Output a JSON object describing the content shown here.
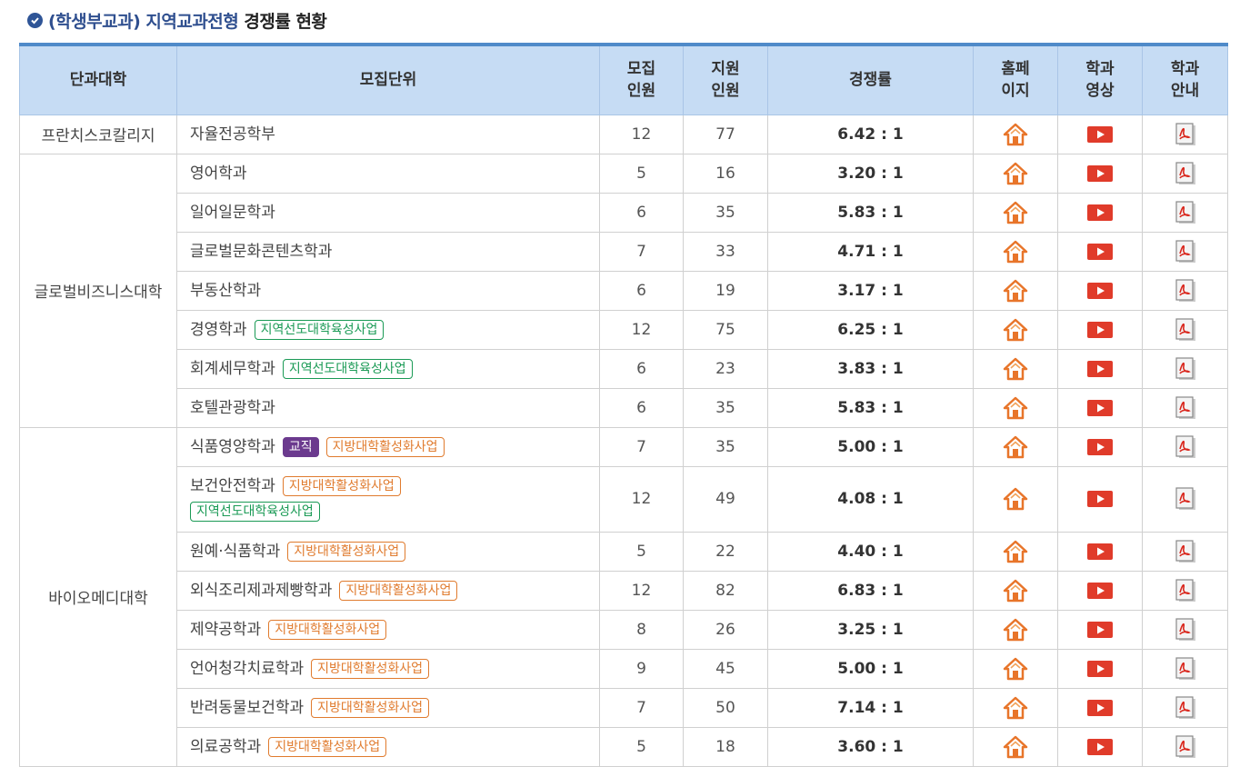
{
  "header": {
    "title_prefix": "(학생부교과) 지역교과전형",
    "title_suffix": "경쟁률 현황",
    "check_icon": "check-circle-icon"
  },
  "table": {
    "columns": {
      "college": "단과대학",
      "unit": "모집단위",
      "quota_line1": "모집",
      "quota_line2": "인원",
      "applicants_line1": "지원",
      "applicants_line2": "인원",
      "ratio": "경쟁률",
      "homepage_line1": "홈페",
      "homepage_line2": "이지",
      "video_line1": "학과",
      "video_line2": "영상",
      "guide_line1": "학과",
      "guide_line2": "안내"
    },
    "colleges": [
      "프란치스코칼리지",
      "글로벌비즈니스대학",
      "바이오메디대학"
    ],
    "rows": [
      {
        "unit": "자율전공학부",
        "quota": "12",
        "applicants": "77",
        "ratio": "6.42 : 1"
      },
      {
        "unit": "영어학과",
        "quota": "5",
        "applicants": "16",
        "ratio": "3.20 : 1"
      },
      {
        "unit": "일어일문학과",
        "quota": "6",
        "applicants": "35",
        "ratio": "5.83 : 1"
      },
      {
        "unit": "글로벌문화콘텐츠학과",
        "quota": "7",
        "applicants": "33",
        "ratio": "4.71 : 1"
      },
      {
        "unit": "부동산학과",
        "quota": "6",
        "applicants": "19",
        "ratio": "3.17 : 1"
      },
      {
        "unit": "경영학과",
        "quota": "12",
        "applicants": "75",
        "ratio": "6.25 : 1",
        "tag1": "지역선도대학육성사업"
      },
      {
        "unit": "회계세무학과",
        "quota": "6",
        "applicants": "23",
        "ratio": "3.83 : 1",
        "tag1": "지역선도대학육성사업"
      },
      {
        "unit": "호텔관광학과",
        "quota": "6",
        "applicants": "35",
        "ratio": "5.83 : 1"
      },
      {
        "unit": "식품영양학과",
        "quota": "7",
        "applicants": "35",
        "ratio": "5.00 : 1",
        "badge": "교직",
        "tag1": "지방대학활성화사업"
      },
      {
        "unit": "보건안전학과",
        "quota": "12",
        "applicants": "49",
        "ratio": "4.08 : 1",
        "tag1": "지방대학활성화사업",
        "tag2": "지역선도대학육성사업"
      },
      {
        "unit": "원예·식품학과",
        "quota": "5",
        "applicants": "22",
        "ratio": "4.40 : 1",
        "tag1": "지방대학활성화사업"
      },
      {
        "unit": "외식조리제과제빵학과",
        "quota": "12",
        "applicants": "82",
        "ratio": "6.83 : 1",
        "tag1": "지방대학활성화사업"
      },
      {
        "unit": "제약공학과",
        "quota": "8",
        "applicants": "26",
        "ratio": "3.25 : 1",
        "tag1": "지방대학활성화사업"
      },
      {
        "unit": "언어청각치료학과",
        "quota": "9",
        "applicants": "45",
        "ratio": "5.00 : 1",
        "tag1": "지방대학활성화사업"
      },
      {
        "unit": "반려동물보건학과",
        "quota": "7",
        "applicants": "50",
        "ratio": "7.14 : 1",
        "tag1": "지방대학활성화사업"
      },
      {
        "unit": "의료공학과",
        "quota": "5",
        "applicants": "18",
        "ratio": "3.60 : 1",
        "tag1": "지방대학활성화사업"
      }
    ]
  },
  "icons": {
    "homepage": "home-icon",
    "video": "youtube-play-icon",
    "guide": "pdf-document-icon"
  },
  "colors": {
    "header_bg": "#c6dcf4",
    "header_border_top": "#4f8ac9",
    "title_blue": "#2f4f8f",
    "tag_green": "#1a9a55",
    "tag_orange": "#e07b2e",
    "badge_purple": "#6b3a8e",
    "home_icon": "#e8752a",
    "video_icon": "#e03b2a"
  }
}
